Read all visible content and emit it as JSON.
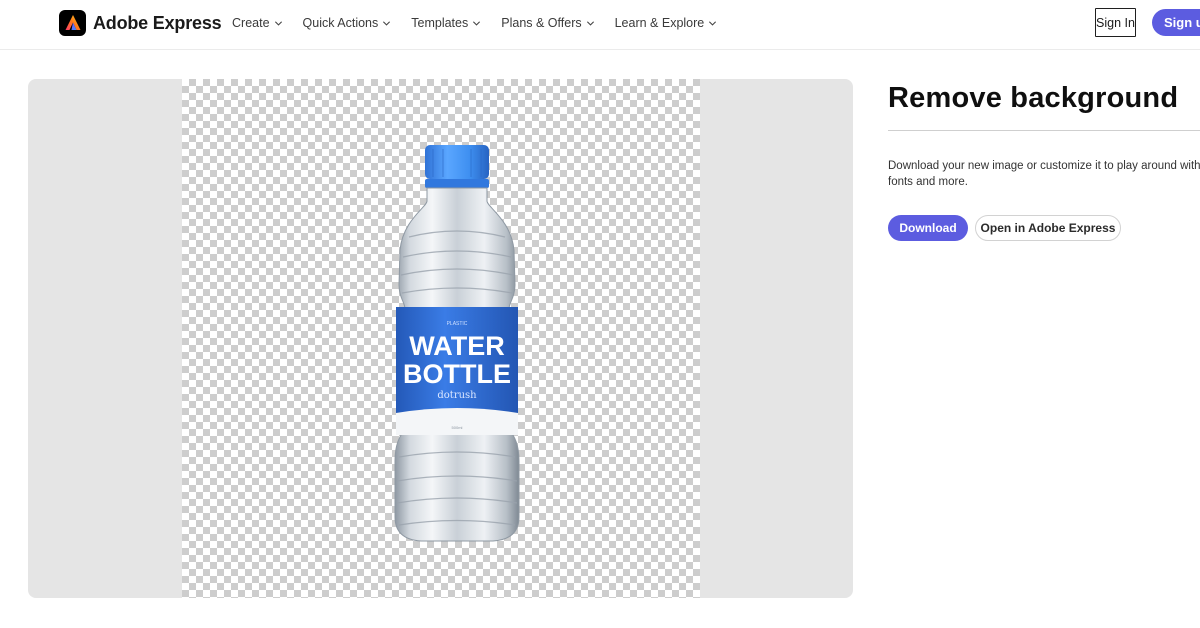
{
  "header": {
    "brand_name": "Adobe Express",
    "nav": [
      {
        "label": "Create"
      },
      {
        "label": "Quick Actions"
      },
      {
        "label": "Templates"
      },
      {
        "label": "Plans & Offers"
      },
      {
        "label": "Learn & Explore"
      }
    ],
    "sign_in_label": "Sign In",
    "sign_up_label": "Sign up"
  },
  "preview": {
    "label": {
      "small_text": "PLASTIC",
      "line1": "WATER",
      "line2": "BOTTLE",
      "brand": "dotrush",
      "volume": "500ml"
    }
  },
  "panel": {
    "title": "Remove background",
    "description": "Download your new image or customize it to play around with fonts and more.",
    "download_label": "Download",
    "open_label": "Open in Adobe Express"
  },
  "colors": {
    "accent": "#5C5CE0",
    "cap_blue": "#3E8FF0",
    "label_blue": "#2F6FD6",
    "preview_bg": "#E5E5E5"
  },
  "icons": [
    "adobe-express-logo-icon",
    "chevron-down-icon"
  ]
}
